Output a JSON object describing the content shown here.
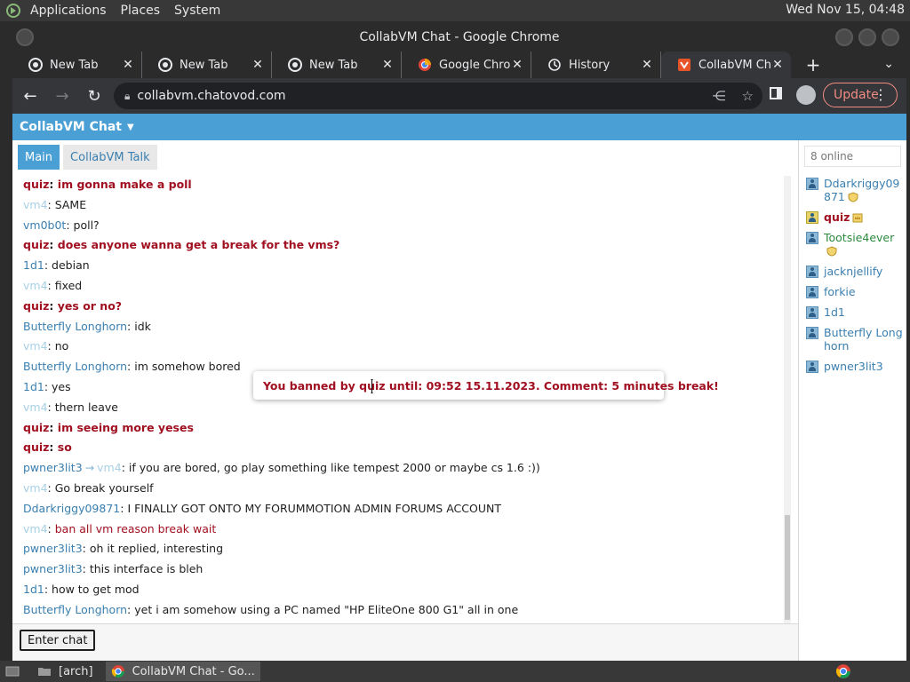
{
  "top_panel": {
    "menus": [
      "Applications",
      "Places",
      "System"
    ],
    "clock": "Wed Nov 15, 04:48"
  },
  "window": {
    "title": "CollabVM Chat - Google Chrome"
  },
  "tabs": [
    {
      "label": "New Tab",
      "icon": "chrome-icon"
    },
    {
      "label": "New Tab",
      "icon": "chrome-icon"
    },
    {
      "label": "New Tab",
      "icon": "chrome-icon"
    },
    {
      "label": "Google Chrom",
      "icon": "google-icon"
    },
    {
      "label": "History",
      "icon": "history-icon"
    },
    {
      "label": "CollabVM Cha",
      "icon": "collabvm-icon",
      "active": true
    }
  ],
  "toolbar": {
    "url": "collabvm.chatovod.com",
    "update_label": "Update"
  },
  "site": {
    "header_title": "CollabVM Chat",
    "chat_tabs": [
      "Main",
      "CollabVM Talk"
    ],
    "enter_chat_label": "Enter chat",
    "online_count": "8 online"
  },
  "messages": [
    {
      "user": "quiz",
      "text": "im gonna make a poll",
      "style": "mod"
    },
    {
      "user": "vm4",
      "text": "SAME",
      "style": "faint"
    },
    {
      "user": "vm0b0t",
      "text": "poll?",
      "style": "blue"
    },
    {
      "user": "quiz",
      "text": "does anyone wanna get a break for the vms?",
      "style": "mod"
    },
    {
      "user": "1d1",
      "text": "debian",
      "style": "blue"
    },
    {
      "user": "vm4",
      "text": "fixed",
      "style": "faint"
    },
    {
      "user": "quiz",
      "text": "yes or no?",
      "style": "mod"
    },
    {
      "user": "Butterfly Longhorn",
      "text": "idk",
      "style": "blue"
    },
    {
      "user": "vm4",
      "text": "no",
      "style": "faint"
    },
    {
      "user": "Butterfly Longhorn",
      "text": "im somehow bored",
      "style": "blue"
    },
    {
      "user": "1d1",
      "text": "yes",
      "style": "blue"
    },
    {
      "user": "vm4",
      "text": "thern leave",
      "style": "faint"
    },
    {
      "user": "quiz",
      "text": "im seeing more yeses",
      "style": "mod"
    },
    {
      "user": "quiz",
      "text": "so",
      "style": "mod"
    },
    {
      "user": "pwner3lit3",
      "to": "vm4",
      "text": "if you are bored, go play something like tempest 2000 or maybe cs 1.6 :))",
      "style": "blue"
    },
    {
      "user": "vm4",
      "text": "Go break yourself",
      "style": "faint"
    },
    {
      "user": "Ddarkriggy09871",
      "text": "I FINALLY GOT ONTO MY FORUMMOTION ADMIN FORUMS ACCOUNT",
      "style": "blue"
    },
    {
      "user": "vm4",
      "text": "ban all vm reason break wait",
      "style": "faint-redtext"
    },
    {
      "user": "pwner3lit3",
      "text": "oh it replied, interesting",
      "style": "blue"
    },
    {
      "user": "pwner3lit3",
      "text": "this interface is bleh",
      "style": "blue"
    },
    {
      "user": "1d1",
      "text": "how to get mod",
      "style": "blue"
    },
    {
      "user": "Butterfly Longhorn",
      "text": "yet i am somehow using a PC named \"HP EliteOne 800 G1\" all in one",
      "style": "blue"
    }
  ],
  "users": [
    {
      "name": "Ddarkriggy09871",
      "style": "blue",
      "badge": "shield-icon"
    },
    {
      "name": "quiz",
      "style": "mod",
      "badge": "crown-icon",
      "avatar": "gold"
    },
    {
      "name": "Tootsie4ever",
      "style": "green",
      "badge": "shield-icon"
    },
    {
      "name": "jacknjellify",
      "style": "blue"
    },
    {
      "name": "forkie",
      "style": "blue"
    },
    {
      "name": "1d1",
      "style": "blue"
    },
    {
      "name": "Butterfly Longhorn",
      "style": "blue"
    },
    {
      "name": "pwner3lit3",
      "style": "blue"
    }
  ],
  "ban_notice": "You banned by quiz until: 09:52 15.11.2023. Comment: 5 minutes break!",
  "taskbar": {
    "items": [
      "[arch]",
      "CollabVM Chat - Go..."
    ]
  },
  "colors": {
    "accent": "#4a9fd4",
    "mod_red": "#a01020",
    "user_blue": "#3a7fb0"
  }
}
